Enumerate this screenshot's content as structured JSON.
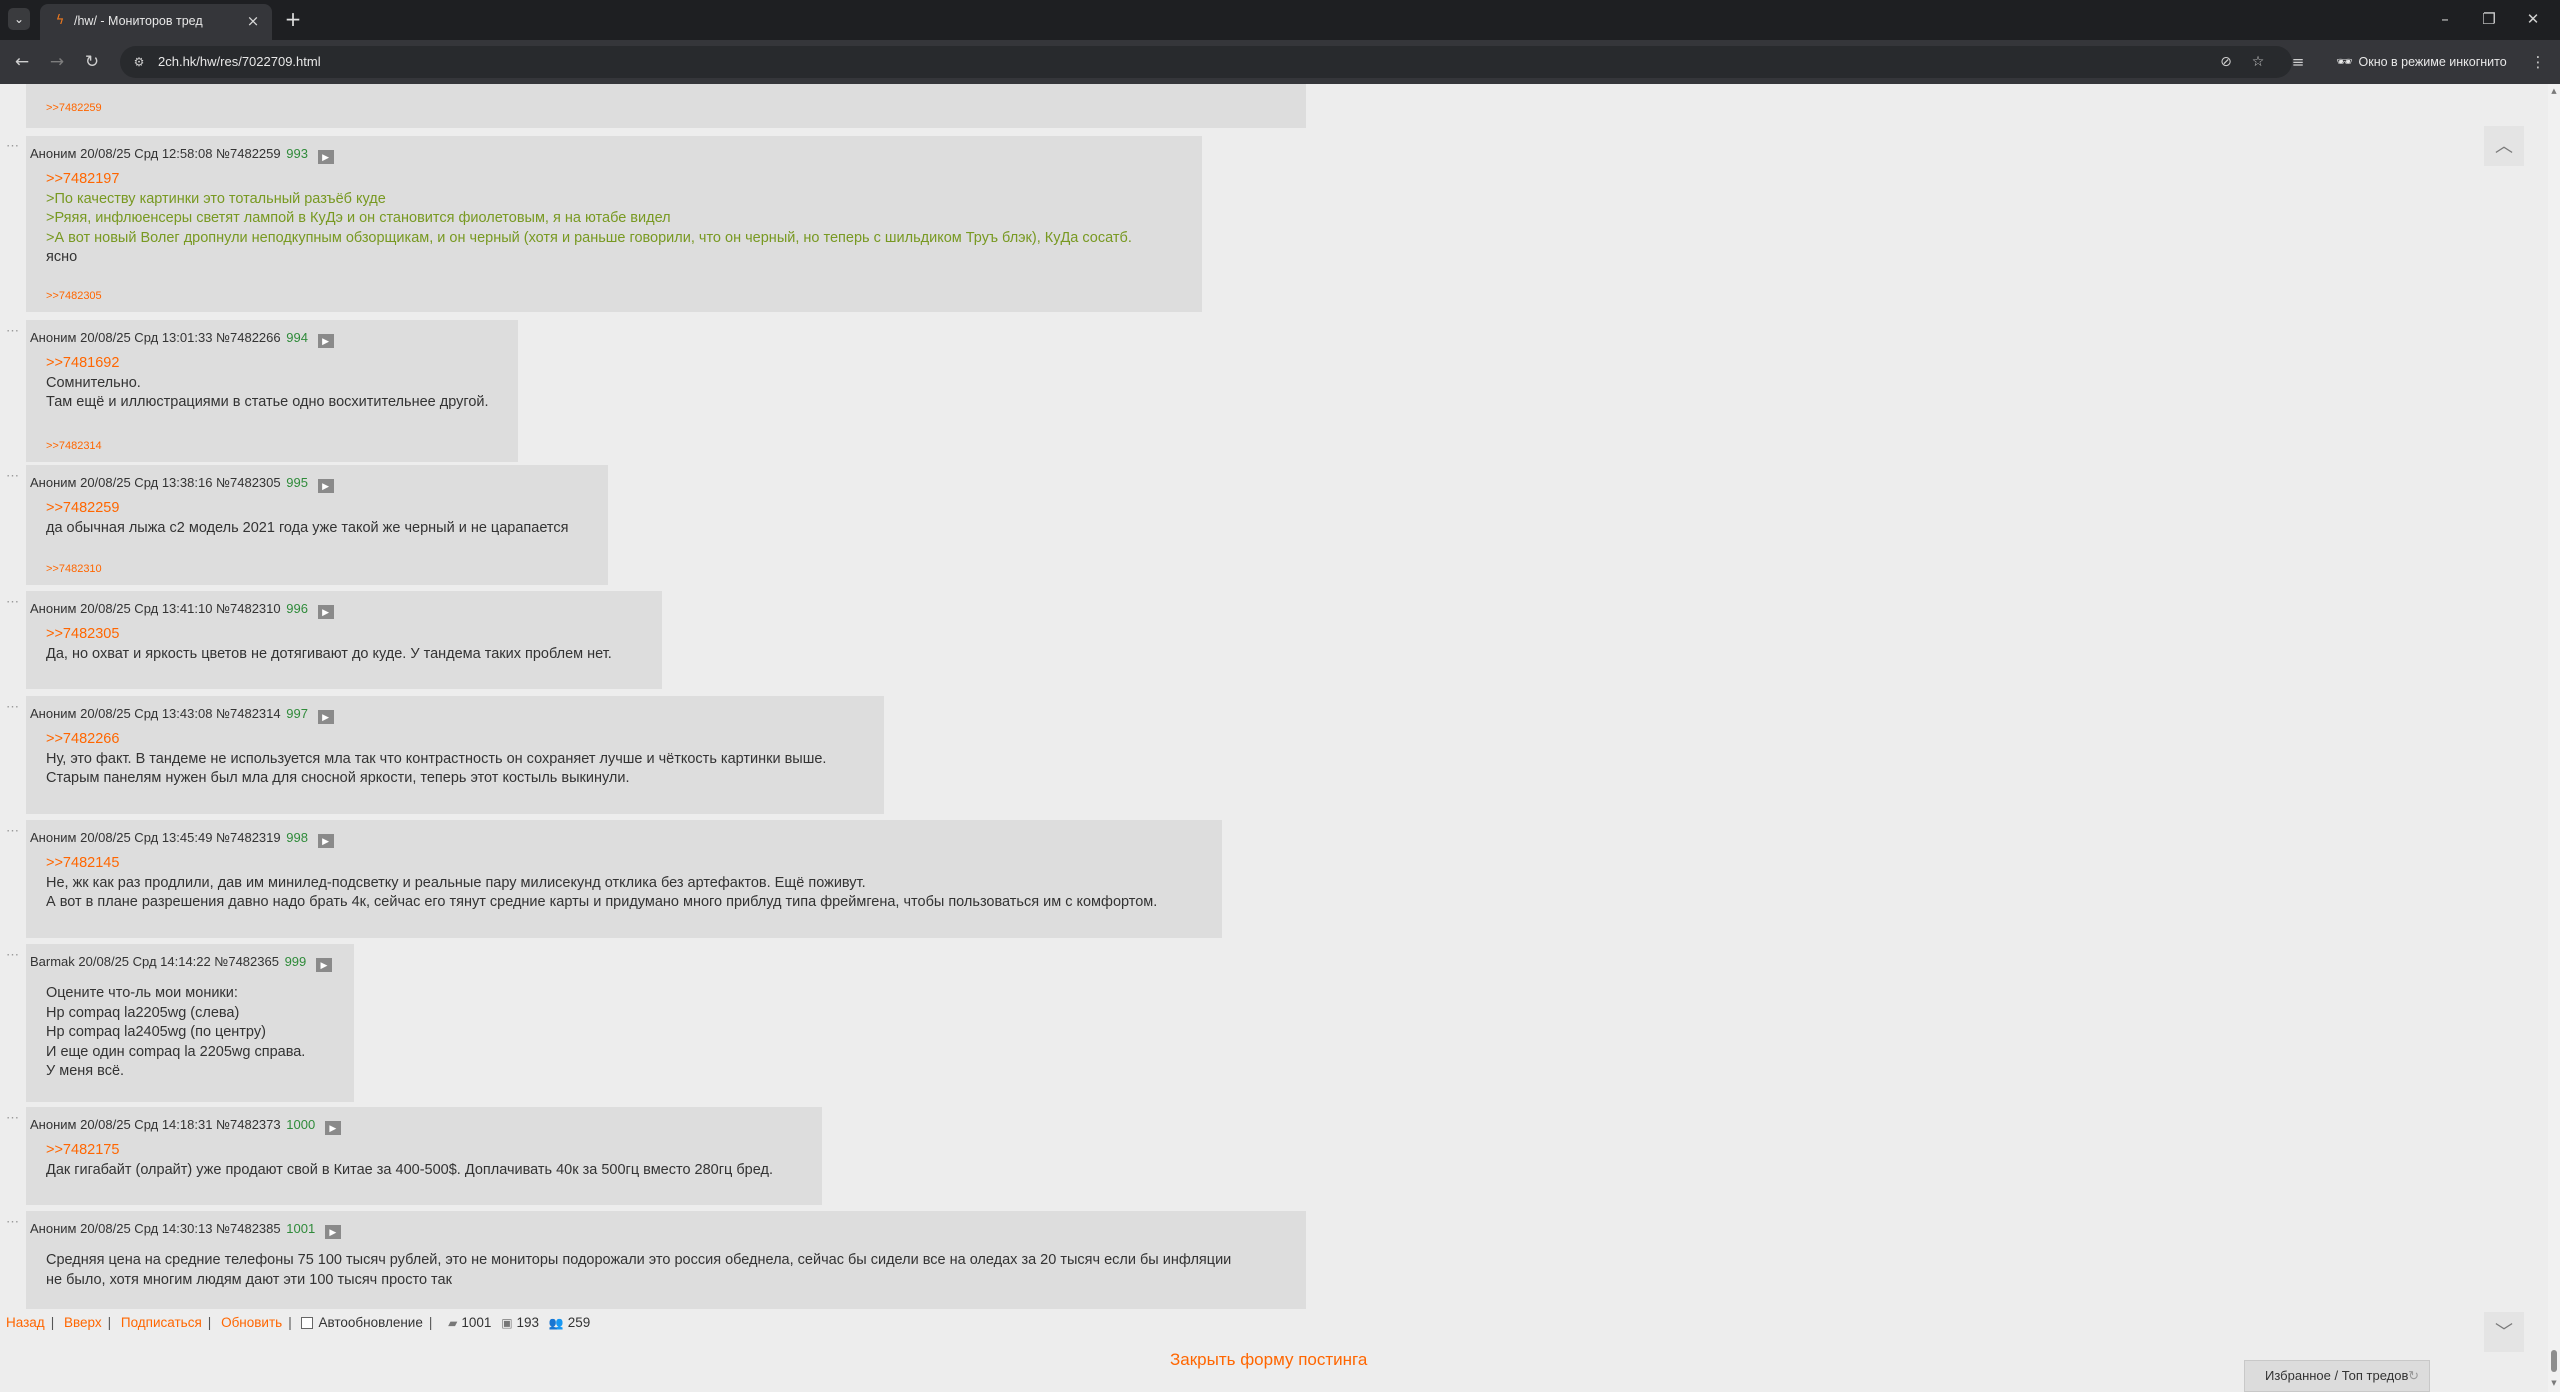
{
  "browser": {
    "tab_title": "/hw/ - Мониторов тред",
    "url": "2ch.hk/hw/res/7022709.html",
    "incognito_label": "Окно в режиме инкогнито"
  },
  "top_partial_post": {
    "reply_link": ">>7482259"
  },
  "posts": [
    {
      "name": "Аноним",
      "date": "20/08/25 Срд 12:58:08",
      "id": "№7482259",
      "num": "993",
      "reflinks": [
        ">>7482197"
      ],
      "quotes": [
        ">По качеству картинки это тотальный разъёб куде",
        ">Ряяя, инфлюенсеры светят лампой в КуДэ и он становится фиолетовым, я на ютабе видел",
        ">А вот новый Волег дропнули неподкупным обзорщикам, и он черный (хотя и раньше говорили, что он черный, но теперь с шильдиком Труъ блэк), КуДа сосатб."
      ],
      "lines": [
        "ясно"
      ],
      "replies": ">>7482305"
    },
    {
      "name": "Аноним",
      "date": "20/08/25 Срд 13:01:33",
      "id": "№7482266",
      "num": "994",
      "reflinks": [
        ">>7481692"
      ],
      "quotes": [],
      "lines": [
        "Сомнительно.",
        "Там ещё и иллюстрациями в статье одно восхитительнее другой."
      ],
      "replies": ">>7482314"
    },
    {
      "name": "Аноним",
      "date": "20/08/25 Срд 13:38:16",
      "id": "№7482305",
      "num": "995",
      "reflinks": [
        ">>7482259"
      ],
      "quotes": [],
      "lines": [
        "да обычная лыжа с2 модель 2021 года уже такой же черный и не царапается"
      ],
      "replies": ">>7482310"
    },
    {
      "name": "Аноним",
      "date": "20/08/25 Срд 13:41:10",
      "id": "№7482310",
      "num": "996",
      "reflinks": [
        ">>7482305"
      ],
      "quotes": [],
      "lines": [
        "Да, но охват и яркость цветов не дотягивают до куде. У тандема таких проблем нет."
      ],
      "replies": ""
    },
    {
      "name": "Аноним",
      "date": "20/08/25 Срд 13:43:08",
      "id": "№7482314",
      "num": "997",
      "reflinks": [
        ">>7482266"
      ],
      "quotes": [],
      "lines": [
        "Ну, это факт. В тандеме не используется мла так что контрастность он сохраняет лучше и чёткость картинки выше.",
        "Старым панелям нужен был мла для сносной яркости, теперь этот костыль выкинули."
      ],
      "replies": ""
    },
    {
      "name": "Аноним",
      "date": "20/08/25 Срд 13:45:49",
      "id": "№7482319",
      "num": "998",
      "reflinks": [
        ">>7482145"
      ],
      "quotes": [],
      "lines": [
        "Не, жк как раз продлили, дав им минилед-подсветку и реальные пару милисекунд отклика без артефактов. Ещё поживут.",
        "А вот в плане разрешения давно надо брать 4к, сейчас его тянут средние карты и придумано много приблуд типа фреймгена, чтобы пользоваться им с комфортом."
      ],
      "replies": ""
    },
    {
      "name": "Barmak",
      "date": "20/08/25 Срд 14:14:22",
      "id": "№7482365",
      "num": "999",
      "reflinks": [],
      "quotes": [],
      "lines": [
        "Оцените что-ль мои моники:",
        "Hp compaq la2205wg (слева)",
        "Hp compaq la2405wg (по центру)",
        "И еще один compaq la 2205wg справа.",
        "У меня всё."
      ],
      "replies": ""
    },
    {
      "name": "Аноним",
      "date": "20/08/25 Срд 14:18:31",
      "id": "№7482373",
      "num": "1000",
      "reflinks": [
        ">>7482175"
      ],
      "quotes": [],
      "lines": [
        "Дак гигабайт (олрайт) уже продают свой в Китае за 400-500$. Доплачивать 40к за 500гц вместо 280гц бред."
      ],
      "replies": ""
    },
    {
      "name": "Аноним",
      "date": "20/08/25 Срд 14:30:13",
      "id": "№7482385",
      "num": "1001",
      "reflinks": [],
      "quotes": [],
      "lines": [
        "Средняя цена на средние телефоны 75 100 тысяч рублей, это не мониторы подорожали это россия обеднела, сейчас бы сидели все на оледах за 20 тысяч если бы инфляции",
        "не было, хотя многим людям дают эти 100 тысяч просто так"
      ],
      "replies": ""
    }
  ],
  "bottom_nav": {
    "back": "Назад",
    "up": "Вверх",
    "subscribe": "Подписаться",
    "refresh": "Обновить",
    "autorefresh": "Автообновление",
    "posts_count": "1001",
    "images_count": "193",
    "posters_count": "259"
  },
  "close_form": "Закрыть форму постинга",
  "favorites": "Избранное / Топ тредов"
}
